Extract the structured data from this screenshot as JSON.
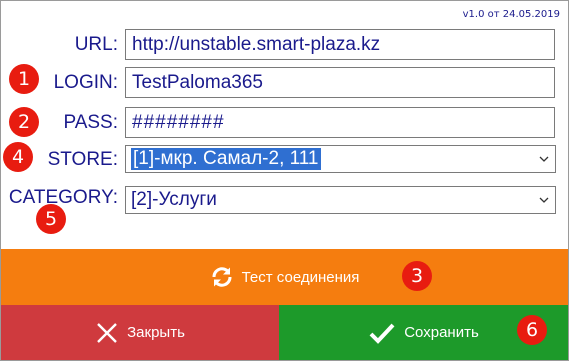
{
  "app": {
    "version": "v1.0 от 24.05.2019"
  },
  "form": {
    "url": {
      "label": "URL:",
      "value": "http://unstable.smart-plaza.kz"
    },
    "login": {
      "label": "LOGIN:",
      "value": "TestPaloma365"
    },
    "pass": {
      "label": "PASS:",
      "value": "########"
    },
    "store": {
      "label": "STORE:",
      "value": "[1]-мкр. Самал-2, 111"
    },
    "category": {
      "label": "CATEGORY:",
      "value": "[2]-Услуги"
    }
  },
  "badges": [
    "1",
    "2",
    "4",
    "5",
    "3",
    "6"
  ],
  "buttons": {
    "test": {
      "label": "Тест соединения",
      "icon": "refresh-icon"
    },
    "close": {
      "label": "Закрыть",
      "icon": "close-icon"
    },
    "save": {
      "label": "Сохранить",
      "icon": "check-icon"
    }
  },
  "colors": {
    "label_text": "#1a1a8c",
    "badge": "#e81c10",
    "test_button": "#f57d0f",
    "close_button": "#cf3a3e",
    "save_button": "#1d9a2a",
    "selection": "#2f6fd1"
  }
}
